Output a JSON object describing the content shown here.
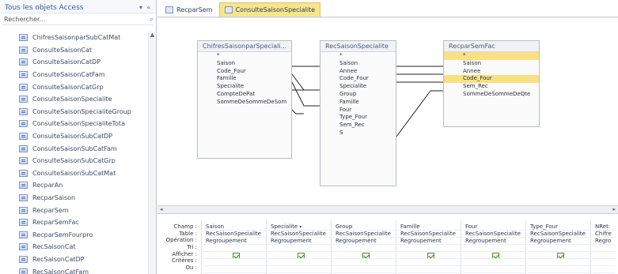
{
  "nav": {
    "title": "Tous les objets Access",
    "search_placeholder": "Rechercher...",
    "items": [
      "ChifresSaisonparSubCatMat",
      "ConsulteSaisonCat",
      "ConsulteSaisonCatDP",
      "ConsulteSaisonCatFam",
      "ConsulteSaisonCatGrp",
      "ConsulteSaisonSpecialite",
      "ConsulteSaisonSpecialiteGroup",
      "ConsulteSaisonSpecialiteTota",
      "ConsulteSaisonSubCatDP",
      "ConsulteSaisonSubCatFam",
      "ConsulteSaisonSubCatGrp",
      "ConsulteSaisonSubCatMat",
      "RecparAn",
      "RecparSaison",
      "RecparSem",
      "RecparSemFac",
      "RecparSemFourpro",
      "RecSaisonCat",
      "RecSaisonCatDP",
      "RecSaisonCatFam"
    ],
    "selected_index": 5
  },
  "tabs": [
    {
      "label": "RecparSem",
      "active": false
    },
    {
      "label": "ConsulteSaisonSpecialite",
      "active": true
    }
  ],
  "tables": [
    {
      "title": "ChifresSaisonparSpeciali...",
      "fields": [
        "*",
        "Saison",
        "Code_Four",
        "Famille",
        "Specialite",
        "CompteDePat",
        "SommeDeSommeDeSom"
      ],
      "highlight": []
    },
    {
      "title": "RecSaisonSpecialite",
      "fields": [
        "*",
        "Saison",
        "Annee",
        "Code_Four",
        "Specialite",
        "Group",
        "Famille",
        "Four",
        "Type_Four",
        "Sem_Rec",
        "S"
      ],
      "highlight": []
    },
    {
      "title": "RecparSemFac",
      "fields": [
        "*",
        "Saison",
        "Annee",
        "Code_Four",
        "Sem_Rec",
        "SommeDeSommeDeQte"
      ],
      "highlight": [
        0,
        3
      ]
    }
  ],
  "grid": {
    "row_labels": [
      "Champ :",
      "Table :",
      "Opération :",
      "Tri :",
      "Afficher :",
      "Critères :",
      "Ou :"
    ],
    "columns": [
      {
        "field": "Saison",
        "table": "RecSaisonSpecialite",
        "op": "Regroupement",
        "show": true,
        "selector": false
      },
      {
        "field": "Specialite",
        "table": "RecSaisonSpecialite",
        "op": "Regroupement",
        "show": true,
        "selector": true
      },
      {
        "field": "Group",
        "table": "RecSaisonSpecialite",
        "op": "Regroupement",
        "show": true,
        "selector": false
      },
      {
        "field": "Famille",
        "table": "RecSaisonSpecialite",
        "op": "Regroupement",
        "show": true,
        "selector": false
      },
      {
        "field": "Four",
        "table": "RecSaisonSpecialite",
        "op": "Regroupement",
        "show": true,
        "selector": false
      },
      {
        "field": "Type_Four",
        "table": "RecSaisonSpecialite",
        "op": "Regroupement",
        "show": true,
        "selector": false
      },
      {
        "field": "NRet:",
        "table": "Chifre",
        "op": "Regro",
        "show": false,
        "selector": false
      }
    ]
  }
}
